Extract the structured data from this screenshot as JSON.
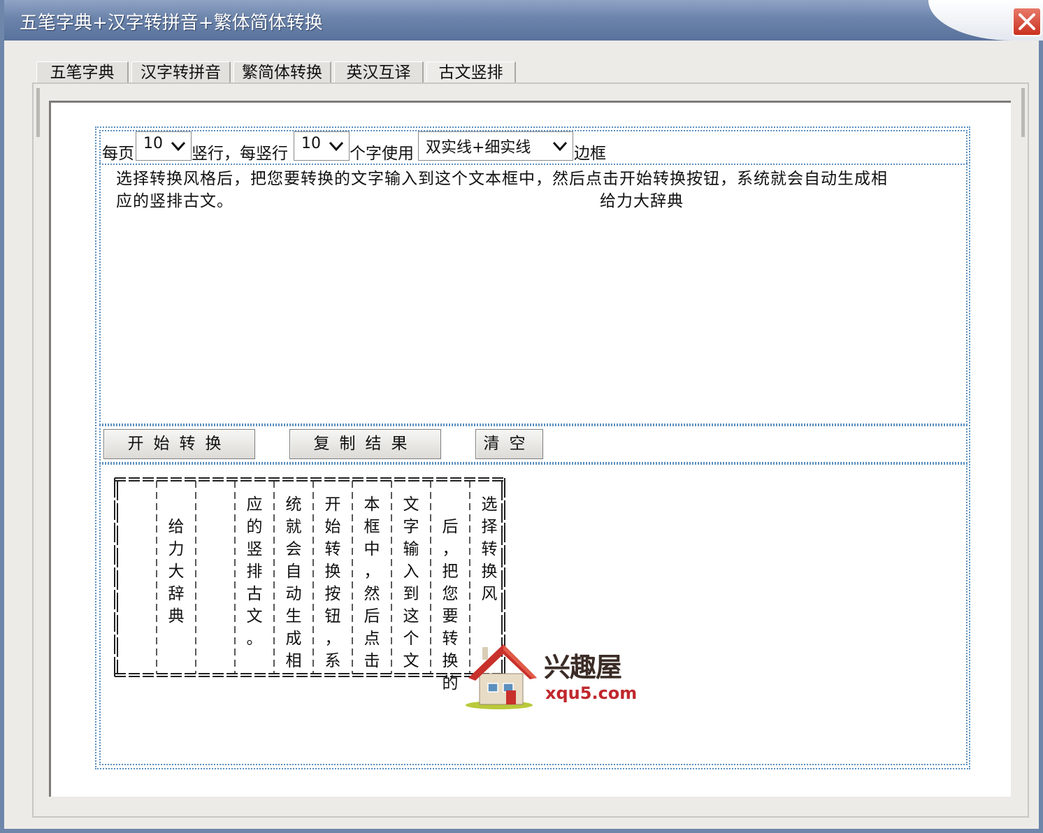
{
  "window": {
    "title": "五笔字典+汉字转拼音+繁体简体转换"
  },
  "tabs": [
    {
      "label": "五笔字典"
    },
    {
      "label": "汉字转拼音"
    },
    {
      "label": "繁简体转换"
    },
    {
      "label": "英汉互译"
    },
    {
      "label": "古文竖排"
    }
  ],
  "options": {
    "per_page_label": "每页",
    "per_page_value": "10",
    "columns_label": "竖行，每竖行",
    "chars_value": "10",
    "chars_label": "个字使用",
    "border_value": "双实线+细实线",
    "border_label": "边框"
  },
  "input_text": {
    "line1": "选择转换风格后，把您要转换的文字输入到这个文本框中，然后点击开始转换按钮，系统就会自动生成相",
    "line2": "应的竖排古文。",
    "signature": "给力大辞典"
  },
  "buttons": {
    "convert": "开始转换",
    "copy": "复制结果",
    "clear": "清空"
  },
  "output": {
    "columns": [
      [
        "选",
        "择",
        "转",
        "换",
        "风",
        ""
      ],
      [
        "",
        "后",
        "，",
        "把",
        "您",
        "要",
        "转",
        "换",
        "的"
      ],
      [
        "文",
        "字",
        "输",
        "入",
        "到",
        "这",
        "个",
        "文"
      ],
      [
        "本",
        "框",
        "中",
        "，",
        "然",
        "后",
        "点",
        "击"
      ],
      [
        "开",
        "始",
        "转",
        "换",
        "按",
        "钮",
        "，",
        "系"
      ],
      [
        "统",
        "就",
        "会",
        "自",
        "动",
        "生",
        "成",
        "相"
      ],
      [
        "应",
        "的",
        "竖",
        "排",
        "古",
        "文",
        "。"
      ],
      [],
      [
        "",
        "给",
        "力",
        "大",
        "辞",
        "典"
      ],
      []
    ]
  },
  "watermark": {
    "brand": "兴趣屋",
    "url": "xqu5.com"
  },
  "colors": {
    "title_bar": "#6c84ab",
    "close_button": "#c9311f",
    "dotted_border": "#5b8fbe",
    "watermark_red": "#c0272d"
  }
}
